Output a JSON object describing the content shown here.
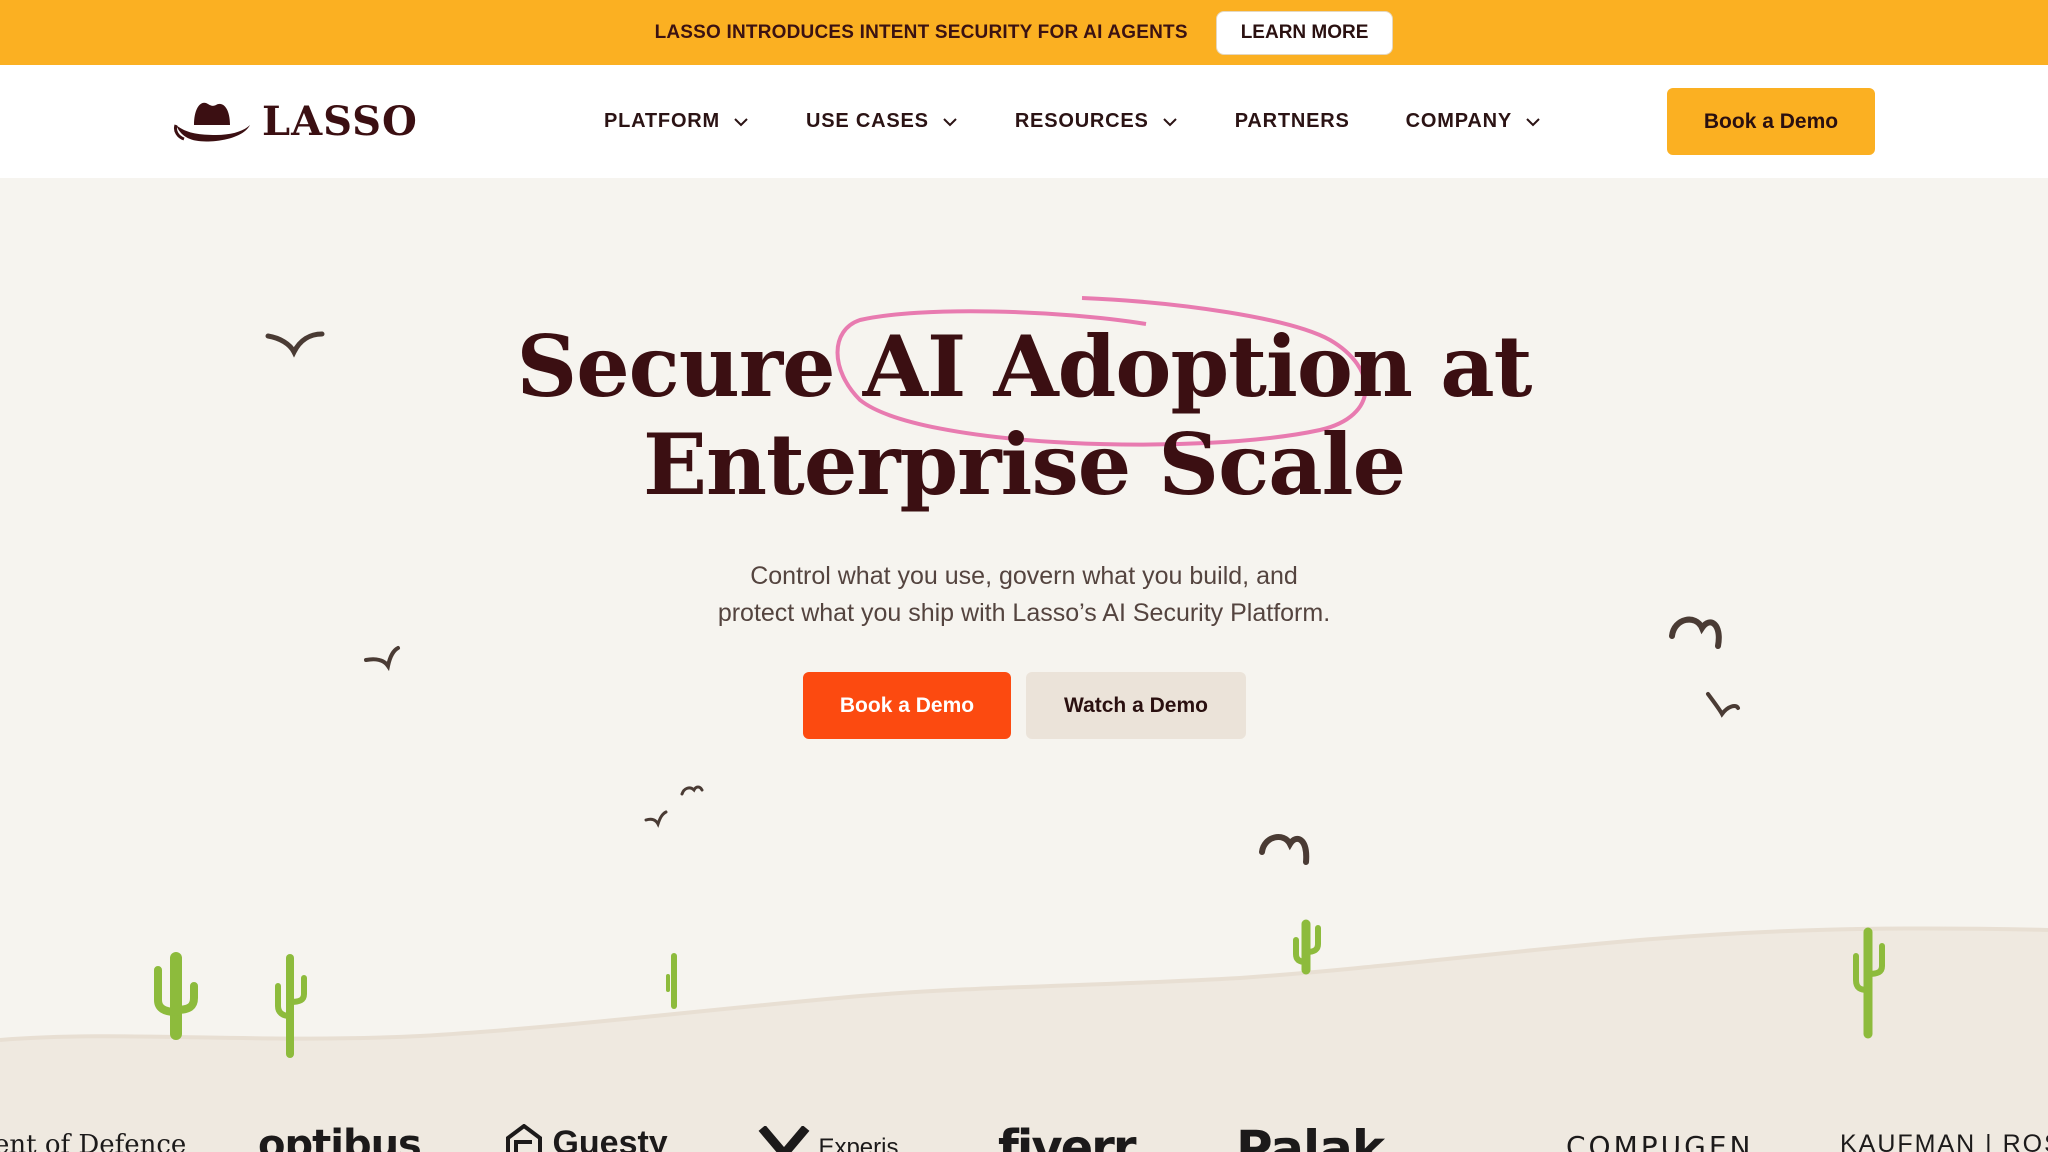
{
  "banner": {
    "text": "LASSO INTRODUCES INTENT SECURITY FOR AI AGENTS",
    "button_label": "LEARN MORE"
  },
  "nav": {
    "logo_text": "LASSO",
    "logo_icon": "cowboy-hat-icon",
    "items": [
      {
        "label": "PLATFORM",
        "has_dropdown": true
      },
      {
        "label": "USE CASES",
        "has_dropdown": true
      },
      {
        "label": "RESOURCES",
        "has_dropdown": true
      },
      {
        "label": "PARTNERS",
        "has_dropdown": false
      },
      {
        "label": "COMPANY",
        "has_dropdown": true
      }
    ],
    "cta_label": "Book a Demo"
  },
  "hero": {
    "title_line1": "Secure AI Adoption at",
    "title_line2": "Enterprise Scale",
    "subtitle_line1": "Control what you use, govern what you build, and",
    "subtitle_line2": "protect what you ship with Lasso’s AI Security Platform.",
    "primary_button": "Book a Demo",
    "secondary_button": "Watch a Demo"
  },
  "customer_logos": [
    "ent of Defence",
    "optibus",
    "Guesty",
    "Experis",
    "fiverr",
    "Palak",
    "COMPUGEN",
    "KAUFMAN | ROSSIN"
  ],
  "colors": {
    "banner_bg": "#fbb022",
    "brand_dark": "#3b0f12",
    "primary_orange": "#fc4a10",
    "page_bg": "#f6f4ef",
    "highlight_pink": "#e87bb0",
    "cactus_green": "#8dbb3c"
  }
}
